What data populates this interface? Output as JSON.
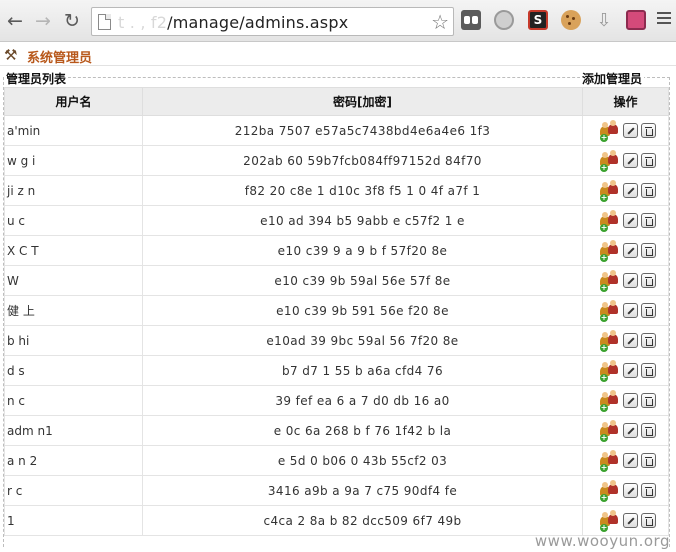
{
  "browser": {
    "url_host": "t  .        ,  f2",
    "url_path": "/manage/admins.aspx"
  },
  "page": {
    "title": "系统管理员"
  },
  "sections": {
    "list_legend": "管理员列表",
    "add_legend": "添加管理员"
  },
  "table": {
    "columns": [
      "用户名",
      "密码[加密]",
      "操作"
    ],
    "rows": [
      {
        "username": "a'min",
        "password": "212ba 7507 e57a5c7438bd4e6a4e6 1f3"
      },
      {
        "username": "w  g  i",
        "password": "202ab  60  59b7fcb084ff97152d  84f70"
      },
      {
        "username": "ji  z   n",
        "password": "f82 20  c8e  1 d10c  3f8  f5 1 0 4f a7f 1"
      },
      {
        "username": "u c",
        "password": "e10 ad 394  b5 9abb  e  c57f2  1  e"
      },
      {
        "username": "X   C   T",
        "password": "e10  c39 9  a  9  b  f   57f20   8e"
      },
      {
        "username": "W",
        "password": "e10  c39  9b  59al    56e  57f   8e"
      },
      {
        "username": "健     上",
        "password": "e10  c39  9b  591     56e   f20   8e"
      },
      {
        "username": "b           hi",
        "password": "e10ad 39  9bc 59al   56   7f20  8e"
      },
      {
        "username": "d s",
        "password": "b7  d7   1 55  b     a6a   cfd4   76"
      },
      {
        "username": "n c",
        "password": "39 fef     ea  6    a  7  d0  db 16   a0"
      },
      {
        "username": "adm n1",
        "password": "e  0c  6a   268  b  f  76   1f42   b  la"
      },
      {
        "username": "a  n  2",
        "password": "e 5d    0   b06   0  43b  55cf2   03"
      },
      {
        "username": "r c",
        "password": "3416   a9b   a 9a   7  c75  90df4    fe"
      },
      {
        "username": "1",
        "password": "c4ca  2  8a  b  82  dcc509  6f7    49b"
      }
    ]
  },
  "watermark": "www.wooyun.org",
  "icons": {
    "row_actions": [
      "users-icon",
      "edit-icon",
      "delete-icon"
    ]
  }
}
